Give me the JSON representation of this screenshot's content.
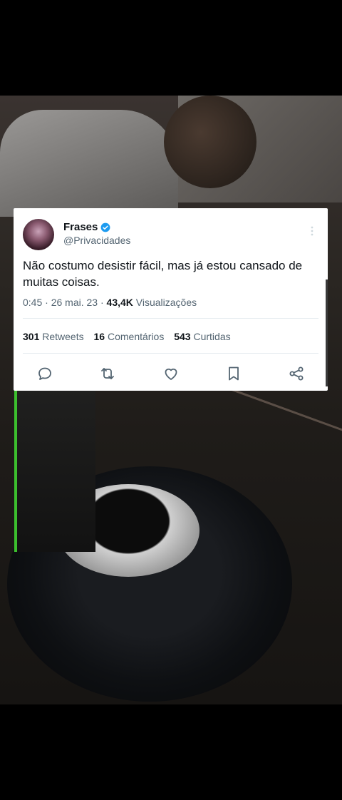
{
  "tweet": {
    "author_name": "Frases",
    "handle": "@Privacidades",
    "text": "Não costumo desistir fácil, mas já estou cansado de muitas coisas.",
    "time": "0:45",
    "date": "26 mai. 23",
    "views_count": "43,4K",
    "views_label": "Visualizações",
    "retweets_count": "301",
    "retweets_label": "Retweets",
    "comments_count": "16",
    "comments_label": "Comentários",
    "likes_count": "543",
    "likes_label": "Curtidas"
  },
  "icons": [
    "verified-badge-icon",
    "more-options-icon",
    "reply-icon",
    "retweet-icon",
    "like-icon",
    "bookmark-icon",
    "share-icon"
  ],
  "colors": {
    "verified": "#1d9bf0",
    "text_primary": "#0f1419",
    "text_secondary": "#536471",
    "icon": "#536471"
  }
}
